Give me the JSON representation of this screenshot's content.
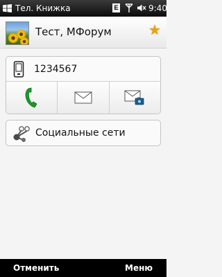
{
  "statusbar": {
    "app_title": "Тел. Книжка",
    "data_indicator": "E",
    "time": "9:40",
    "icons": [
      "windows-start-icon",
      "edge-data-icon",
      "signal-icon",
      "speaker-muted-icon"
    ]
  },
  "contact": {
    "name": "Тест, МФорум",
    "favorite_color": "#f0a010",
    "phone_number": "1234567"
  },
  "actions": [
    {
      "name": "call-button",
      "icon": "phone-handset-icon"
    },
    {
      "name": "sms-button",
      "icon": "envelope-icon"
    },
    {
      "name": "mms-button",
      "icon": "envelope-camera-icon"
    }
  ],
  "social": {
    "label": "Социальные сети",
    "icon": "social-networks-icon"
  },
  "softkeys": {
    "left": "Отменить",
    "right": "Меню"
  },
  "colors": {
    "call_green": "#1a9a2a",
    "star_orange": "#f0a010",
    "statusbar_bg": "#1a1a1a"
  }
}
